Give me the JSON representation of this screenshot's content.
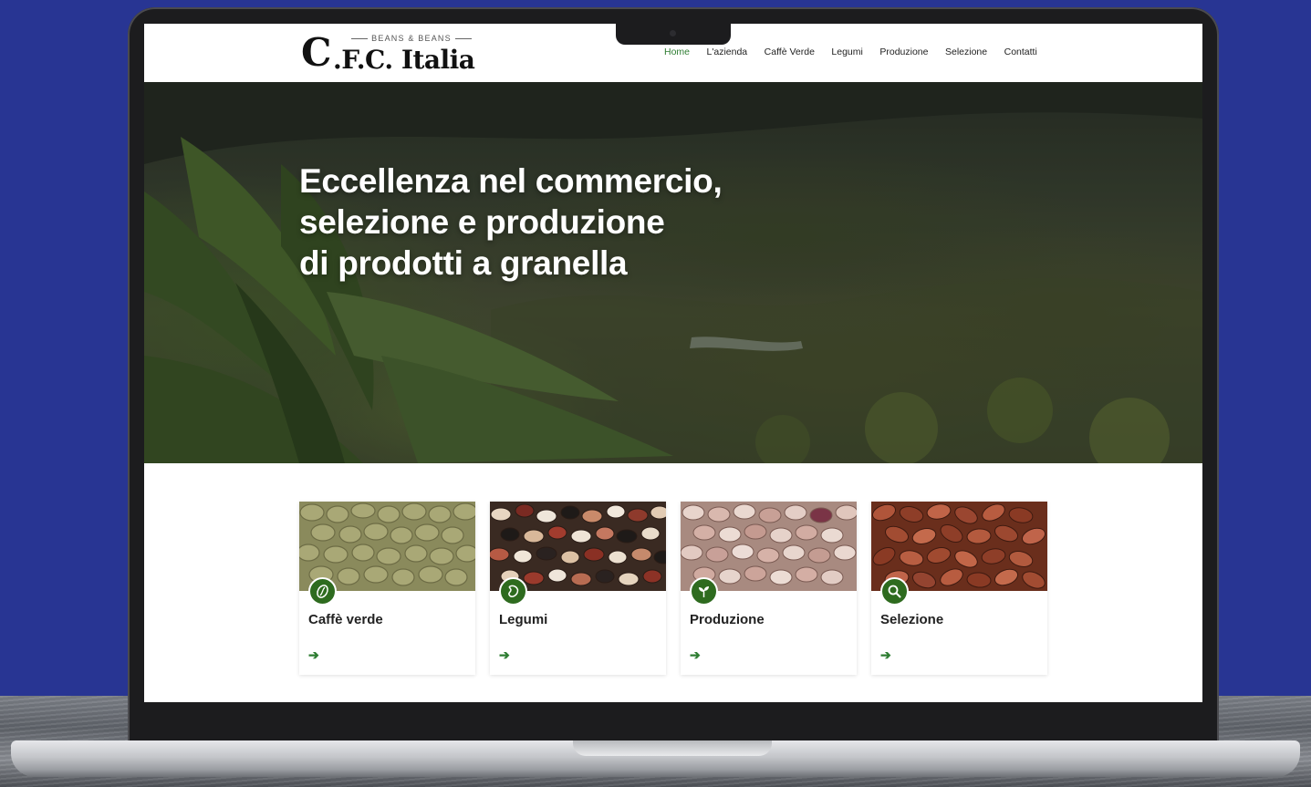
{
  "brand": {
    "tagline": "BEANS & BEANS",
    "logo_initial": "C",
    "logo_name": ".F.C. Italia"
  },
  "nav": {
    "items": [
      {
        "label": "Home",
        "active": true
      },
      {
        "label": "L'azienda",
        "active": false
      },
      {
        "label": "Caffè Verde",
        "active": false
      },
      {
        "label": "Legumi",
        "active": false
      },
      {
        "label": "Produzione",
        "active": false
      },
      {
        "label": "Selezione",
        "active": false
      },
      {
        "label": "Contatti",
        "active": false
      }
    ]
  },
  "hero": {
    "title_lines": [
      "Eccellenza nel commercio,",
      "selezione e produzione",
      "di prodotti a granella"
    ]
  },
  "cards": [
    {
      "title": "Caffè verde",
      "icon": "coffee-bean-icon",
      "arrow": "➔"
    },
    {
      "title": "Legumi",
      "icon": "bean-icon",
      "arrow": "➔"
    },
    {
      "title": "Produzione",
      "icon": "sprout-icon",
      "arrow": "➔"
    },
    {
      "title": "Selezione",
      "icon": "search-icon",
      "arrow": "➔"
    }
  ],
  "colors": {
    "background": "#283593",
    "accent_green": "#2e7d32",
    "icon_green": "#2e6b1f"
  }
}
